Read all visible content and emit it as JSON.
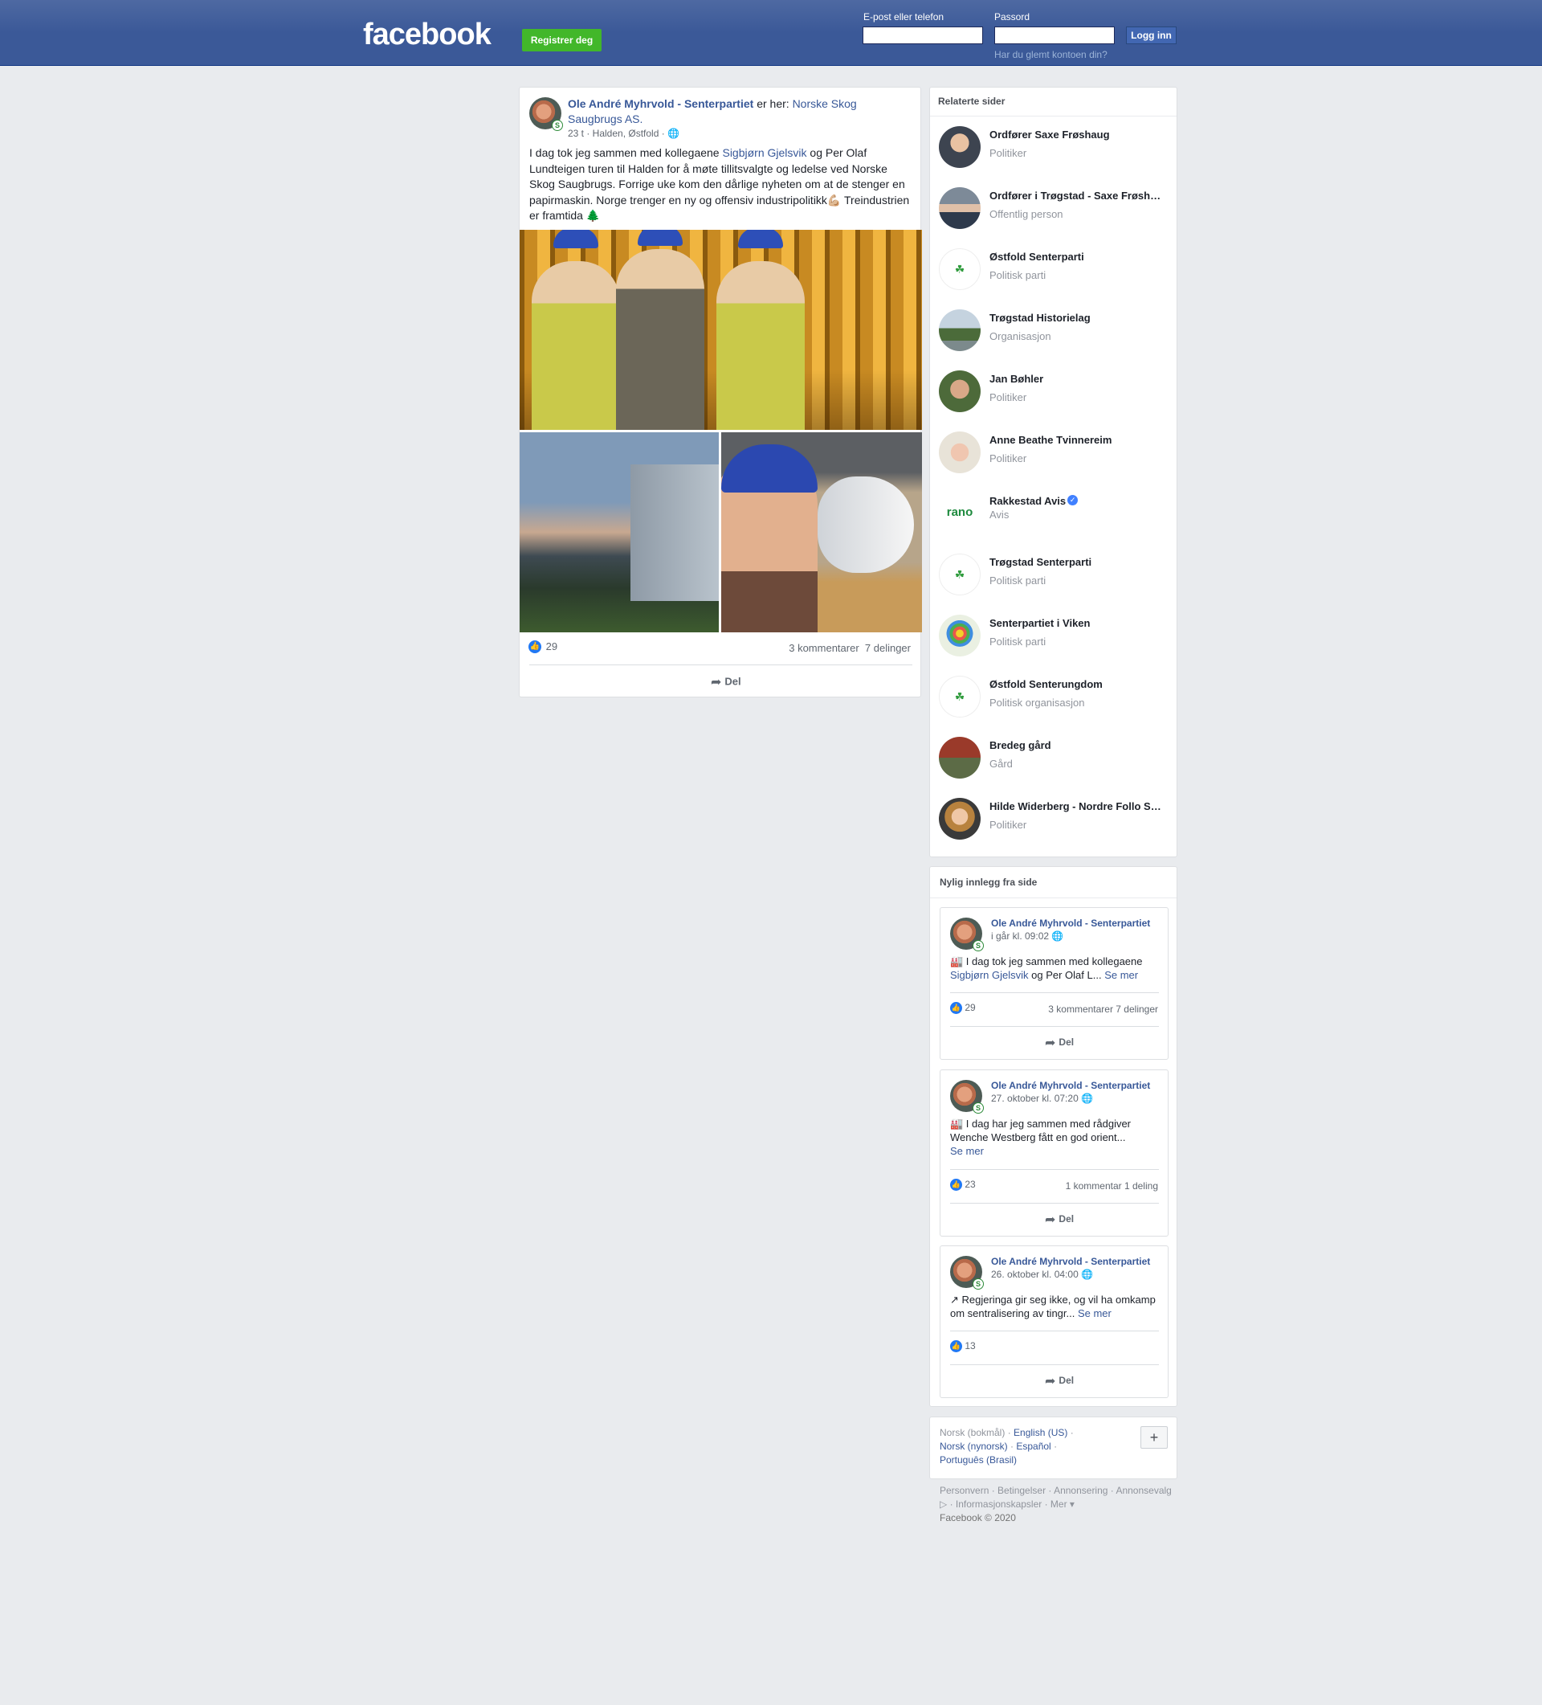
{
  "header": {
    "logo": "facebook",
    "register_label": "Registrer deg",
    "email_label": "E-post eller telefon",
    "password_label": "Passord",
    "login_label": "Logg inn",
    "forgot_label": "Har du glemt kontoen din?",
    "brand_color": "#3b5998"
  },
  "post": {
    "author": "Ole André Myhrvold - Senterpartiet",
    "is_at": " er her: ",
    "place": "Norske Skog Saugbrugs AS.",
    "meta": "23 t · Halden, Østfold · ",
    "globe_icon": "globe-icon",
    "text_before": "I dag tok jeg sammen med kollegaene ",
    "mention": "Sigbjørn Gjelsvik",
    "text_after": " og Per Olaf Lundteigen turen til Halden for å møte tillitsvalgte og ledelse ved Norske Skog Saugbrugs. Forrige uke kom den dårlige nyheten om at de stenger en papirmaskin. Norge trenger en ny og offensiv industripolitikk💪🏼 Treindustrien er framtida 🌲",
    "likes": "29",
    "comments": "3 kommentarer",
    "shares": "7 delinger",
    "share_label": "Del"
  },
  "related": {
    "title": "Relaterte sider",
    "items": [
      {
        "name": "Ordfører Saxe Frøshaug",
        "category": "Politiker"
      },
      {
        "name": "Ordfører i Trøgstad - Saxe Frøshaug",
        "category": "Offentlig person"
      },
      {
        "name": "Østfold Senterparti",
        "category": "Politisk parti"
      },
      {
        "name": "Trøgstad Historielag",
        "category": "Organisasjon"
      },
      {
        "name": "Jan Bøhler",
        "category": "Politiker"
      },
      {
        "name": "Anne Beathe Tvinnereim",
        "category": "Politiker"
      },
      {
        "name": "Rakkestad Avis",
        "category": "Avis"
      },
      {
        "name": "Trøgstad Senterparti",
        "category": "Politisk parti"
      },
      {
        "name": "Senterpartiet i Viken",
        "category": "Politisk parti"
      },
      {
        "name": "Østfold Senterungdom",
        "category": "Politisk organisasjon"
      },
      {
        "name": "Bredeg gård",
        "category": "Gård"
      },
      {
        "name": "Hilde Widerberg - Nordre Follo Senterparti",
        "category": "Politiker"
      }
    ],
    "rano_logo": "rano"
  },
  "recent": {
    "title": "Nylig innlegg fra side",
    "posts": [
      {
        "author": "Ole André Myhrvold - Senterpartiet",
        "time": "i går kl. 09:02",
        "text_before": "🏭 I dag tok jeg sammen med kollegaene ",
        "link": "Sigbjørn Gjelsvik",
        "text_after": " og Per Olaf L... ",
        "see_more": "Se mer",
        "likes": "29",
        "counts": "3 kommentarer  7 delinger",
        "share_label": "Del"
      },
      {
        "author": "Ole André Myhrvold - Senterpartiet",
        "time": "27. oktober kl. 07:20",
        "text_before": "🏭 I dag har jeg sammen med rådgiver Wenche Westberg fått en god orient... ",
        "link": "",
        "text_after": "",
        "see_more": "Se mer",
        "likes": "23",
        "counts": "1 kommentar  1 deling",
        "share_label": "Del"
      },
      {
        "author": "Ole André Myhrvold - Senterpartiet",
        "time": "26. oktober kl. 04:00",
        "text_before": "↗ Regjeringa gir seg ikke, og vil ha omkamp om sentralisering av tingr... ",
        "link": "",
        "text_after": "",
        "see_more": "Se mer",
        "likes": "13",
        "counts": "",
        "share_label": "Del"
      }
    ]
  },
  "languages": {
    "current": "Norsk (bokmål)",
    "others": [
      "English (US)",
      "Norsk (nynorsk)",
      "Español",
      "Português (Brasil)"
    ],
    "plus": "+"
  },
  "footer": {
    "links": "Personvern · Betingelser · Annonsering · Annonsevalg ▷ · Informasjonskapsler · Mer ▾",
    "copyright": "Facebook © 2020"
  }
}
